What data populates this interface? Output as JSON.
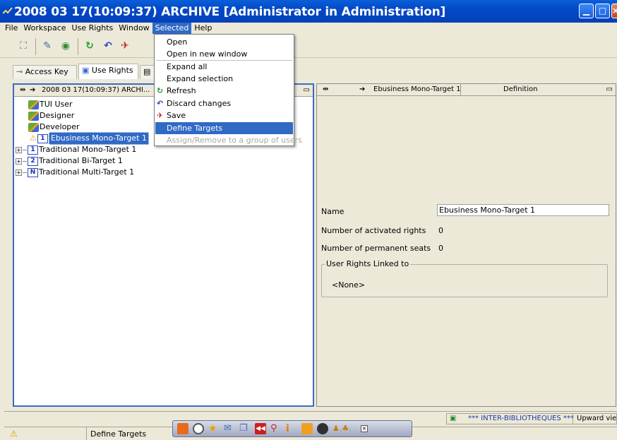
{
  "window": {
    "title": "2008 03 17(10:09:37) ARCHIVE [Administrator in Administration]",
    "min_icon": "minimize-icon",
    "max_icon": "maximize-icon",
    "close_icon": "close-icon"
  },
  "menu": {
    "items": [
      "File",
      "Workspace",
      "Use Rights",
      "Window",
      "Selected",
      "Help"
    ],
    "selected": "Selected"
  },
  "dropdown": {
    "items": [
      {
        "label": "Open",
        "icon": "",
        "state": "normal"
      },
      {
        "label": "Open in new window",
        "icon": "",
        "state": "normal"
      },
      {
        "label": "Expand all",
        "icon": "",
        "state": "normal"
      },
      {
        "label": "Expand selection",
        "icon": "",
        "state": "normal"
      },
      {
        "label": "Refresh",
        "icon": "refresh-icon",
        "state": "normal"
      },
      {
        "label": "Discard changes",
        "icon": "undo-icon",
        "state": "normal"
      },
      {
        "label": "Save",
        "icon": "save-icon",
        "state": "normal"
      },
      {
        "label": "Define Targets",
        "icon": "",
        "state": "selected"
      },
      {
        "label": "Assign/Remove to a group of users",
        "icon": "",
        "state": "disabled"
      }
    ]
  },
  "tabs": [
    {
      "label": "Access Key",
      "icon": "key-icon"
    },
    {
      "label": "Use Rights",
      "icon": "use-rights-icon"
    },
    {
      "label": "",
      "icon": "document-icon"
    }
  ],
  "left_panel": {
    "header": "2008 03 17(10:09:37) ARCHI...",
    "tree": [
      {
        "label": "TUI User",
        "icon": "user-role-icon",
        "selected": false,
        "expander": false,
        "warning": false
      },
      {
        "label": "Designer",
        "icon": "user-role-icon",
        "selected": false,
        "expander": false,
        "warning": false
      },
      {
        "label": "Developer",
        "icon": "user-role-icon",
        "selected": false,
        "expander": false,
        "warning": false
      },
      {
        "label": "Ebusiness Mono-Target 1",
        "icon": "target-1-icon",
        "selected": true,
        "expander": false,
        "warning": true
      },
      {
        "label": "Traditional Mono-Target 1",
        "icon": "target-1-icon",
        "selected": false,
        "expander": true,
        "warning": false
      },
      {
        "label": "Traditional Bi-Target 1",
        "icon": "target-2-icon",
        "selected": false,
        "expander": true,
        "warning": false
      },
      {
        "label": "Traditional Multi-Target 1",
        "icon": "target-n-icon",
        "selected": false,
        "expander": true,
        "warning": false
      }
    ]
  },
  "right_panel": {
    "header_title": "Ebusiness Mono-Target 1",
    "header_definition": "Definition",
    "fields": {
      "name_label": "Name",
      "name_value": "Ebusiness Mono-Target 1",
      "activated_label": "Number of activated rights",
      "activated_value": "0",
      "seats_label": "Number of permanent seats",
      "seats_value": "0"
    },
    "group_title": "User Rights Linked to",
    "group_value": "<None>"
  },
  "status": {
    "left_text": "Define Targets",
    "library": "*** INTER-BIBLIOTHEQUES ***",
    "view": "Upward view"
  }
}
